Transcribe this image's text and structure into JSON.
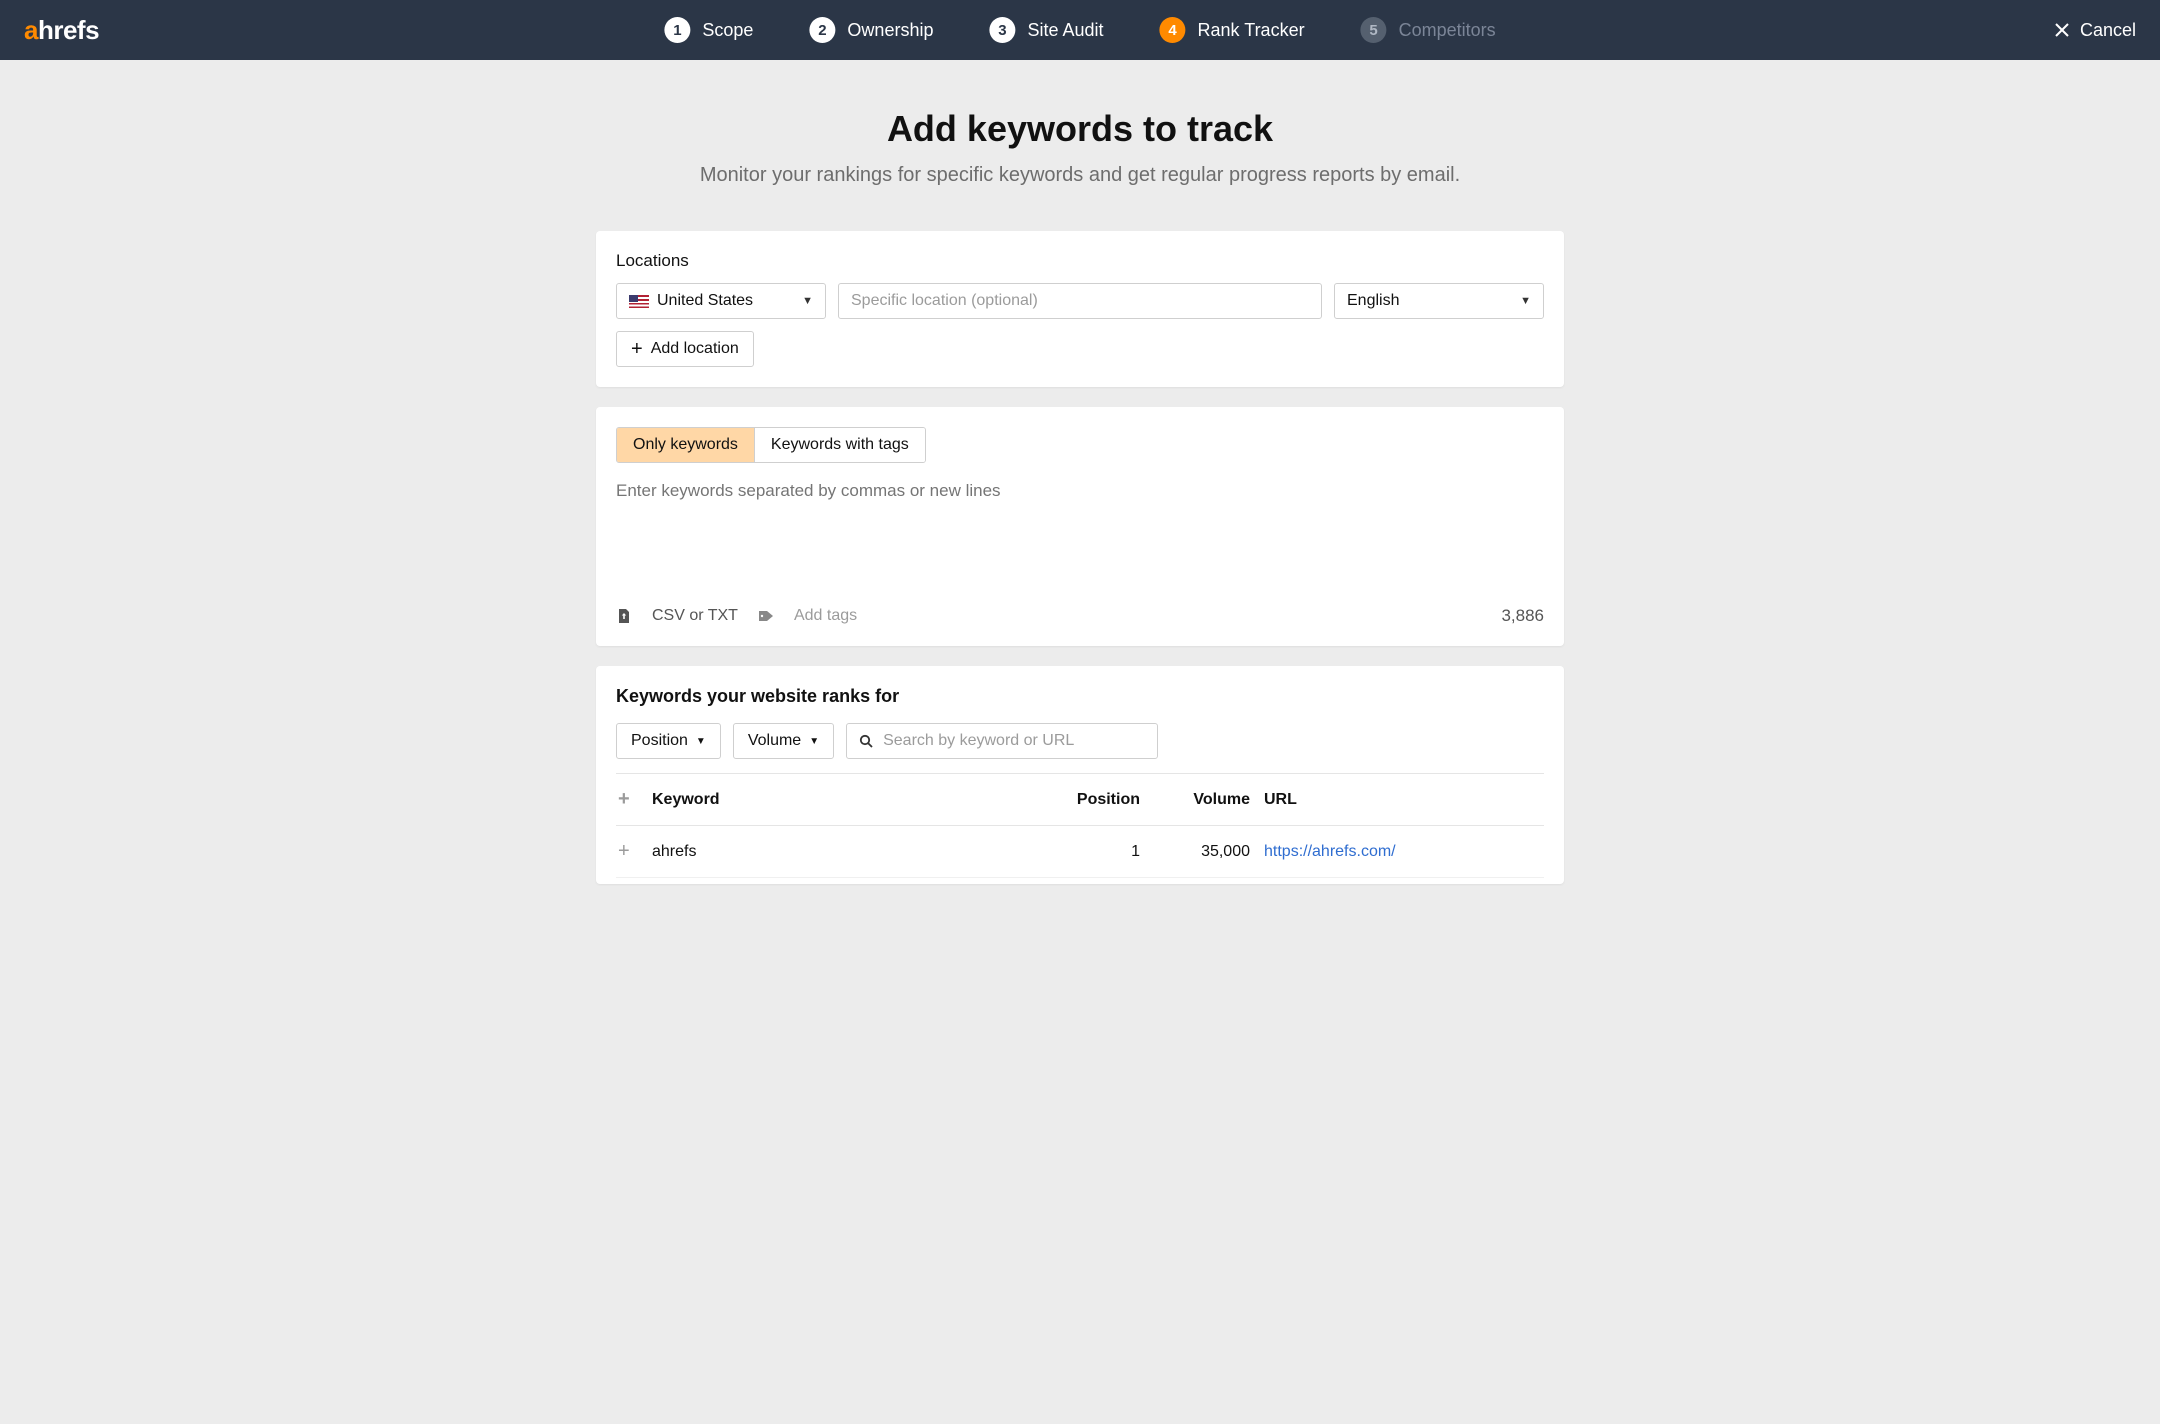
{
  "header": {
    "logo_a": "a",
    "logo_rest": "hrefs",
    "steps": [
      {
        "num": "1",
        "label": "Scope",
        "state": "done"
      },
      {
        "num": "2",
        "label": "Ownership",
        "state": "done"
      },
      {
        "num": "3",
        "label": "Site Audit",
        "state": "done"
      },
      {
        "num": "4",
        "label": "Rank Tracker",
        "state": "active"
      },
      {
        "num": "5",
        "label": "Competitors",
        "state": "disabled"
      }
    ],
    "cancel": "Cancel"
  },
  "page": {
    "title": "Add keywords to track",
    "subtitle": "Monitor your rankings for specific keywords and get regular progress reports by email."
  },
  "locations": {
    "label": "Locations",
    "country": "United States",
    "specific_placeholder": "Specific location (optional)",
    "language": "English",
    "add_location": "Add location"
  },
  "keywords": {
    "seg_only": "Only keywords",
    "seg_tags": "Keywords with tags",
    "textarea_placeholder": "Enter keywords separated by commas or new lines",
    "csv_txt": "CSV or TXT",
    "add_tags": "Add tags",
    "remaining": "3,886"
  },
  "ranks": {
    "title": "Keywords your website ranks for",
    "filter_position": "Position",
    "filter_volume": "Volume",
    "search_placeholder": "Search by keyword or URL",
    "columns": {
      "keyword": "Keyword",
      "position": "Position",
      "volume": "Volume",
      "url": "URL"
    },
    "rows": [
      {
        "keyword": "ahrefs",
        "position": "1",
        "volume": "35,000",
        "url": "https://ahrefs.com/"
      }
    ]
  }
}
